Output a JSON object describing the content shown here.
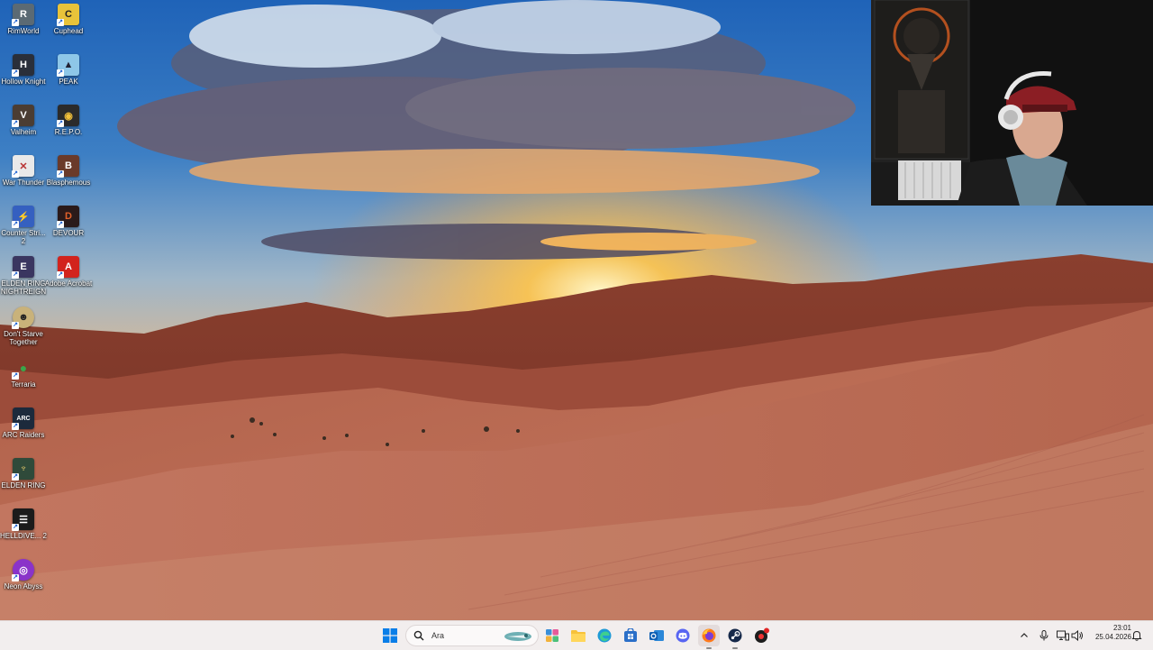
{
  "desktop": {
    "icons": [
      {
        "label": "RimWorld",
        "icon": "rimworld-icon",
        "color": "#5b6a74"
      },
      {
        "label": "Cuphead",
        "icon": "cuphead-icon",
        "color": "#e8c33a"
      },
      {
        "label": "Hollow Knight",
        "icon": "hollow-knight-icon",
        "color": "#2a2f3a"
      },
      {
        "label": "PEAK",
        "icon": "peak-icon",
        "color": "#8ec7e8"
      },
      {
        "label": "Valheim",
        "icon": "valheim-icon",
        "color": "#4b3d33"
      },
      {
        "label": "R.E.P.O.",
        "icon": "repo-icon",
        "color": "#2b2b2b"
      },
      {
        "label": "War Thunder",
        "icon": "war-thunder-icon",
        "color": "#b83232"
      },
      {
        "label": "Blasphemous",
        "icon": "blasphemous-icon",
        "color": "#6a3a2a"
      },
      {
        "label": "Counter Stri... 2",
        "icon": "counter-strike-icon",
        "color": "#3560c0"
      },
      {
        "label": "DEVOUR",
        "icon": "devour-icon",
        "color": "#2a1a1a"
      },
      {
        "label": "ELDEN RING NIGHTREIGN",
        "icon": "elden-ring-nightreign-icon",
        "color": "#3a3660"
      },
      {
        "label": "Adobe Acrobat",
        "icon": "acrobat-icon",
        "color": "#d2231d"
      },
      {
        "label": "Don't Starve Together",
        "icon": "dont-starve-icon",
        "color": "#c9b27a"
      },
      {
        "label": "Terraria",
        "icon": "terraria-icon",
        "color": "#3aa64a"
      },
      {
        "label": "ARC Raiders",
        "icon": "arc-raiders-icon",
        "color": "#1c2a3c"
      },
      {
        "label": "ELDEN RING",
        "icon": "elden-ring-icon",
        "color": "#2f4a3a"
      },
      {
        "label": "HELLDIVE... 2",
        "icon": "helldivers-icon",
        "color": "#1b1b1b"
      },
      {
        "label": "Neon Abyss",
        "icon": "neon-abyss-icon",
        "color": "#8a33c9"
      }
    ]
  },
  "taskbar": {
    "search_placeholder": "Ara",
    "apps": [
      {
        "name": "start",
        "icon": "windows-start-icon"
      },
      {
        "name": "widgets",
        "icon": "widgets-icon"
      },
      {
        "name": "file-explorer",
        "icon": "folder-icon"
      },
      {
        "name": "edge",
        "icon": "edge-icon"
      },
      {
        "name": "store",
        "icon": "store-icon"
      },
      {
        "name": "outlook",
        "icon": "outlook-icon"
      },
      {
        "name": "discord",
        "icon": "discord-icon"
      },
      {
        "name": "firefox",
        "icon": "firefox-icon"
      },
      {
        "name": "steam",
        "icon": "steam-icon"
      },
      {
        "name": "app",
        "icon": "app-icon"
      }
    ],
    "clock": {
      "time": "23:01",
      "date": "25.04.2026"
    },
    "colors": {
      "accent": "#0067c0",
      "taskbar_bg": "#f2eeee"
    }
  }
}
